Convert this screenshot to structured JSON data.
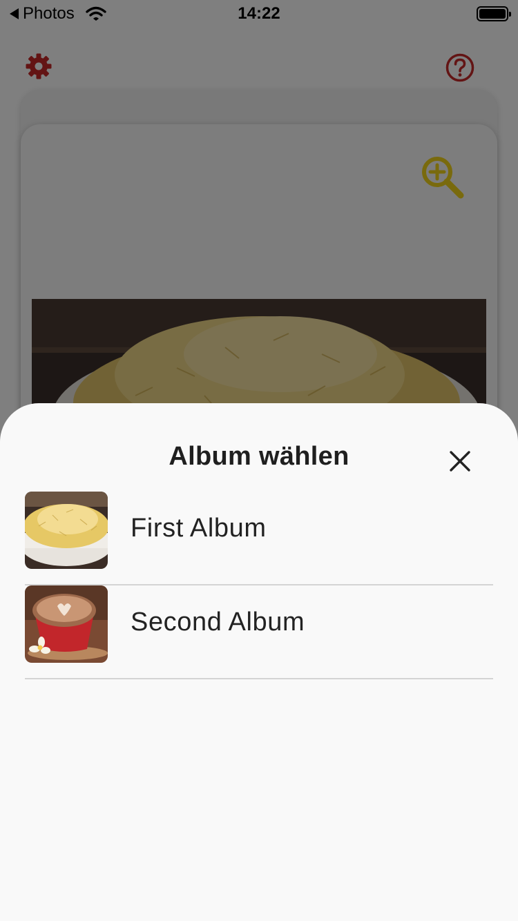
{
  "status_bar": {
    "back_app": "Photos",
    "time": "14:22"
  },
  "toolbar": {
    "settings_icon": "gear-icon",
    "help_icon": "question-circle-icon",
    "accent_color": "#c62828"
  },
  "card": {
    "zoom_icon": "zoom-in-icon",
    "zoom_color": "#f2d51a",
    "photo": "grated-cheese-bowl"
  },
  "sheet": {
    "title": "Album wählen",
    "close_icon": "close-icon",
    "albums": [
      {
        "name": "First Album",
        "thumbnail": "grated-cheese-bowl"
      },
      {
        "name": "Second Album",
        "thumbnail": "latte-art-cup"
      }
    ]
  }
}
